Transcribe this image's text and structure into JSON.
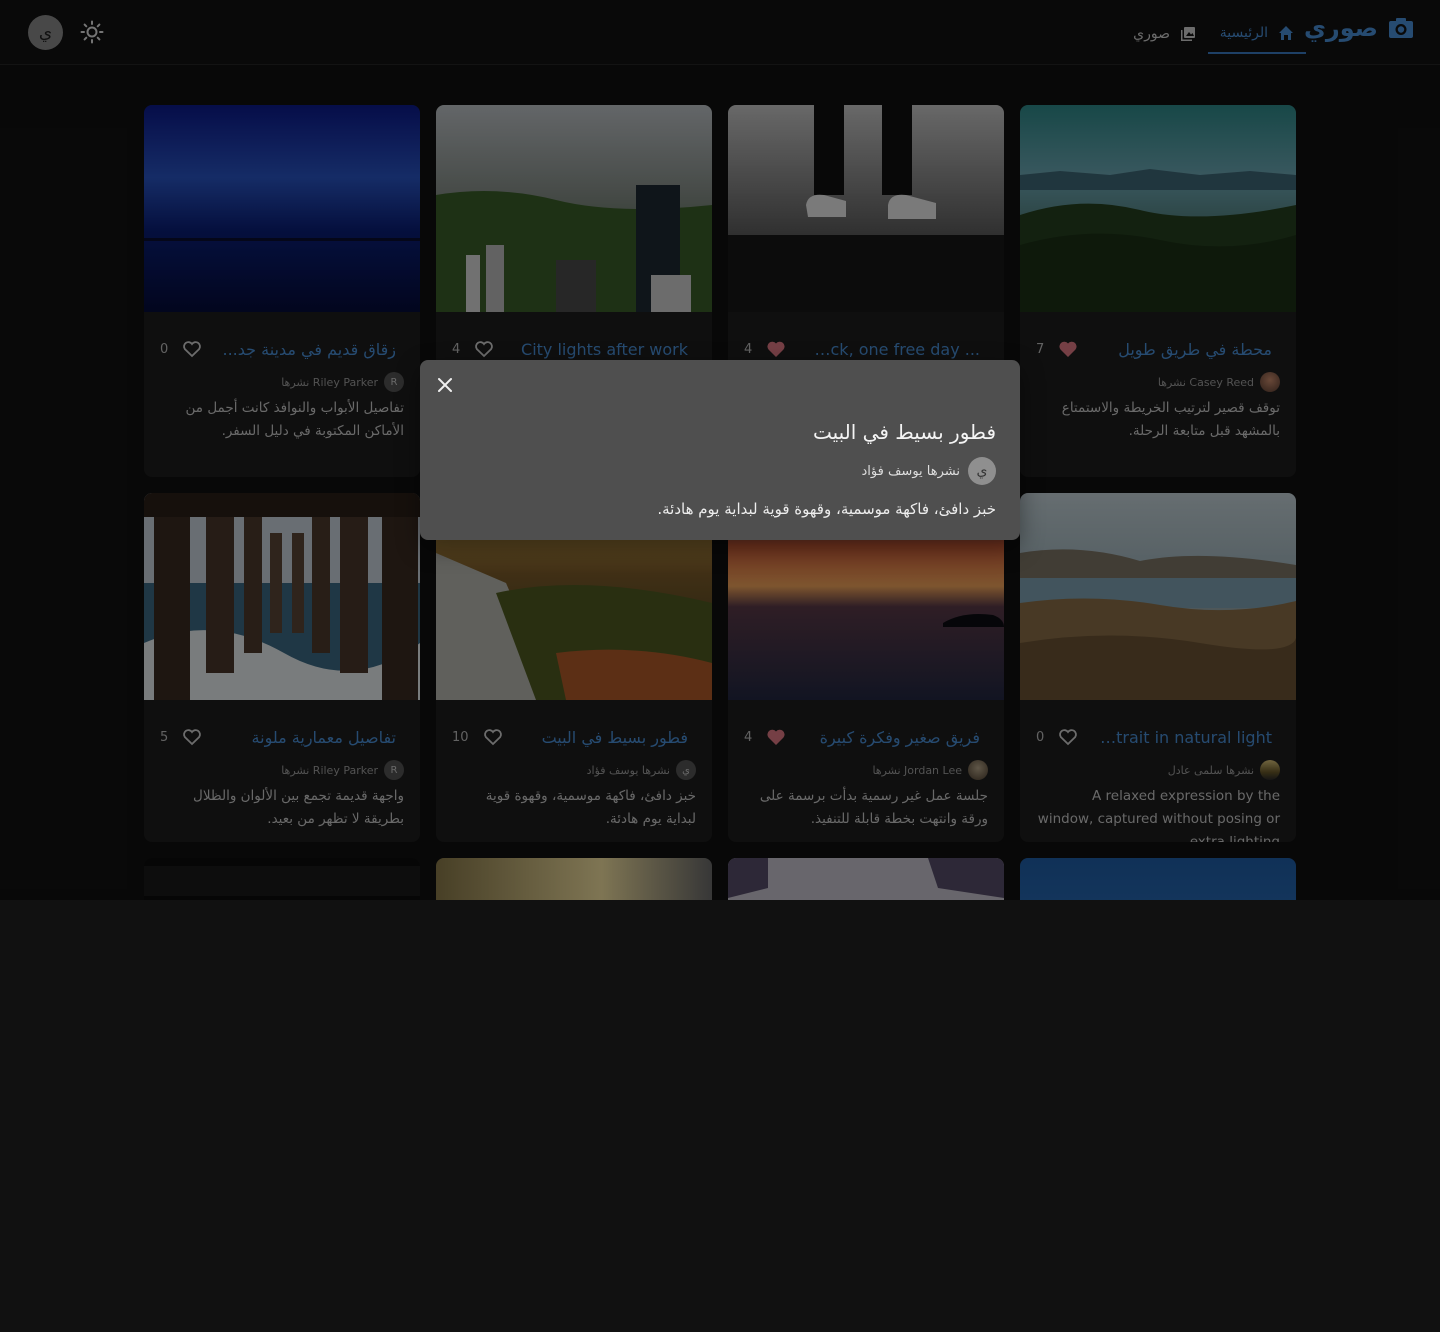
{
  "app": {
    "brand_name": "صوري",
    "brand_icon": "camera-icon",
    "accent_color": "#4a90d9",
    "nav": [
      {
        "label": "الرئيسية",
        "icon": "home-icon",
        "active": true
      },
      {
        "label": "صوري",
        "icon": "photo-library-icon",
        "active": false
      }
    ],
    "theme_toggle_icon": "sun-icon",
    "user_avatar_letter": "ي"
  },
  "cards": [
    {
      "title": "محطة في طريق طويل",
      "likes": "7",
      "liked": true,
      "author": "Casey Reed نشرها",
      "author_avatar": "photo",
      "desc": "توقف قصير لترتيب الخريطة والاستمتاع بالمشهد قبل متابعة الرحلة."
    },
    {
      "title": "... backpack, one free day",
      "likes": "4",
      "liked": true,
      "author": "",
      "author_avatar": "",
      "desc": ""
    },
    {
      "title": "City lights after work",
      "likes": "4",
      "liked": false,
      "author": "",
      "author_avatar": "",
      "desc": ""
    },
    {
      "title": "زقاق قديم في مدينة جد...",
      "likes": "0",
      "liked": false,
      "author": "Riley Parker نشرها",
      "author_avatar": "R",
      "desc": "تفاصيل الأبواب والنوافذ كانت أجمل من الأماكن المكتوبة في دليل السفر."
    },
    {
      "title": "Portrait in natural light",
      "likes": "0",
      "liked": false,
      "author": "نشرها سلمى عادل",
      "author_avatar": "photo",
      "desc": "A relaxed expression by the window, captured without posing or extra lighting."
    },
    {
      "title": "فريق صغير وفكرة كبيرة",
      "likes": "4",
      "liked": true,
      "author": "Jordan Lee نشرها",
      "author_avatar": "photo",
      "desc": "جلسة عمل غير رسمية بدأت برسمة على ورقة وانتهت بخطة قابلة للتنفيذ."
    },
    {
      "title": "فطور بسيط في البيت",
      "likes": "10",
      "liked": false,
      "author": "نشرها يوسف فؤاد",
      "author_avatar": "ي",
      "desc": "خبز دافئ، فاكهة موسمية، وقهوة قوية لبداية يوم هادئة."
    },
    {
      "title": "تفاصيل معمارية ملونة",
      "likes": "5",
      "liked": false,
      "author": "Riley Parker نشرها",
      "author_avatar": "R",
      "desc": "واجهة قديمة تجمع بين الألوان والظلال بطريقة لا تظهر من بعيد."
    }
  ],
  "modal": {
    "close_icon": "close-icon",
    "title": "فطور بسيط في البيت",
    "author": "نشرها يوسف فؤاد",
    "author_avatar_letter": "ي",
    "description": "خبز دافئ، فاكهة موسمية، وقهوة قوية لبداية يوم هادئة."
  }
}
